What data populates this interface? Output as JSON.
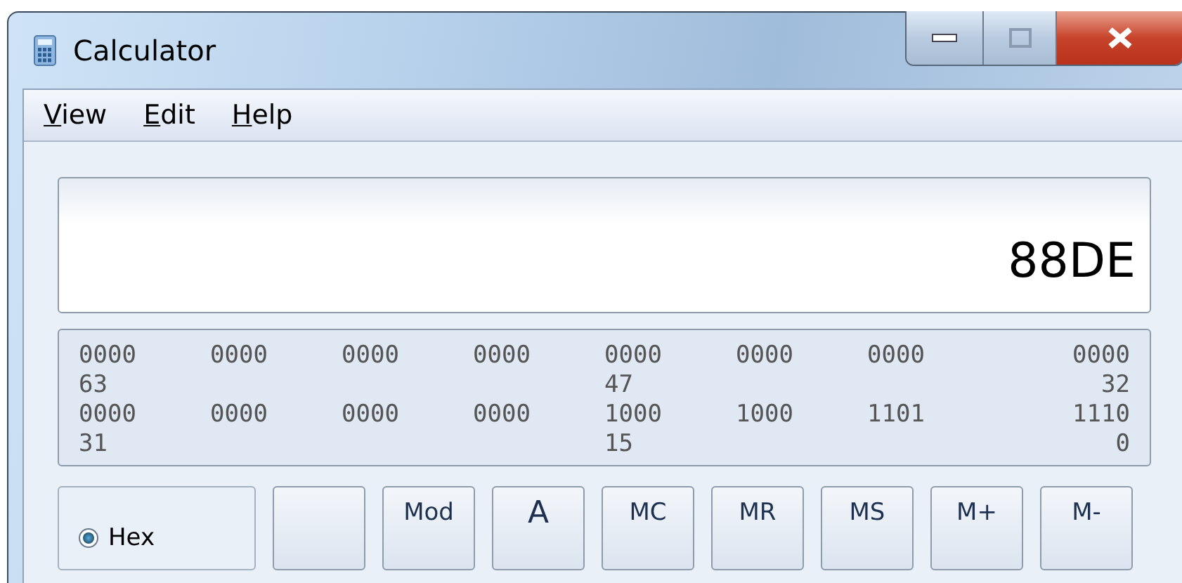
{
  "window": {
    "title": "Calculator"
  },
  "menu": [
    {
      "label": "View"
    },
    {
      "label": "Edit"
    },
    {
      "label": "Help"
    }
  ],
  "display": {
    "value": "88DE"
  },
  "bits": {
    "rows": [
      {
        "groups": [
          "0000",
          "0000",
          "0000",
          "0000",
          "0000",
          "0000",
          "0000",
          "0000"
        ],
        "marks": {
          "high": "63",
          "middle": "47",
          "low": "32"
        }
      },
      {
        "groups": [
          "0000",
          "0000",
          "0000",
          "0000",
          "1000",
          "1000",
          "1101",
          "1110"
        ],
        "marks": {
          "high": "31",
          "middle": "15",
          "low": "0"
        }
      }
    ]
  },
  "base_radio": {
    "label": "Hex",
    "selected": true
  },
  "buttons": [
    {
      "kind": "blank"
    },
    {
      "label": "Mod"
    },
    {
      "label": "A"
    },
    {
      "label": "MC"
    },
    {
      "label": "MR"
    },
    {
      "label": "MS"
    },
    {
      "label": "M+"
    },
    {
      "label": "M-"
    }
  ]
}
